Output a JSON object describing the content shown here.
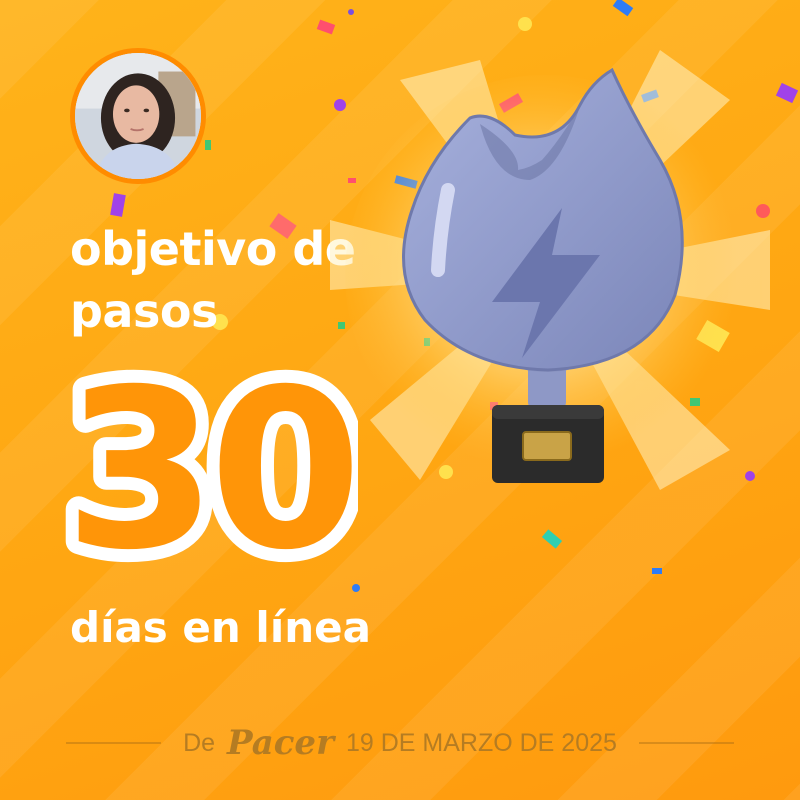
{
  "headline": "objetivo de pasos",
  "big_number": "30",
  "subline": "días en línea",
  "footer": {
    "prefix": "De",
    "brand": "Pacer",
    "date": "19 DE MARZO DE 2025"
  },
  "colors": {
    "background": "#ffa612",
    "accent_orange": "#ff8c00",
    "text_white": "#ffffff",
    "footer_text": "#b57c22",
    "trophy_body": "#8f99c8",
    "trophy_base": "#2b2b2b"
  },
  "icons": {
    "trophy": "flame-trophy-icon",
    "bolt": "lightning-bolt-icon"
  }
}
